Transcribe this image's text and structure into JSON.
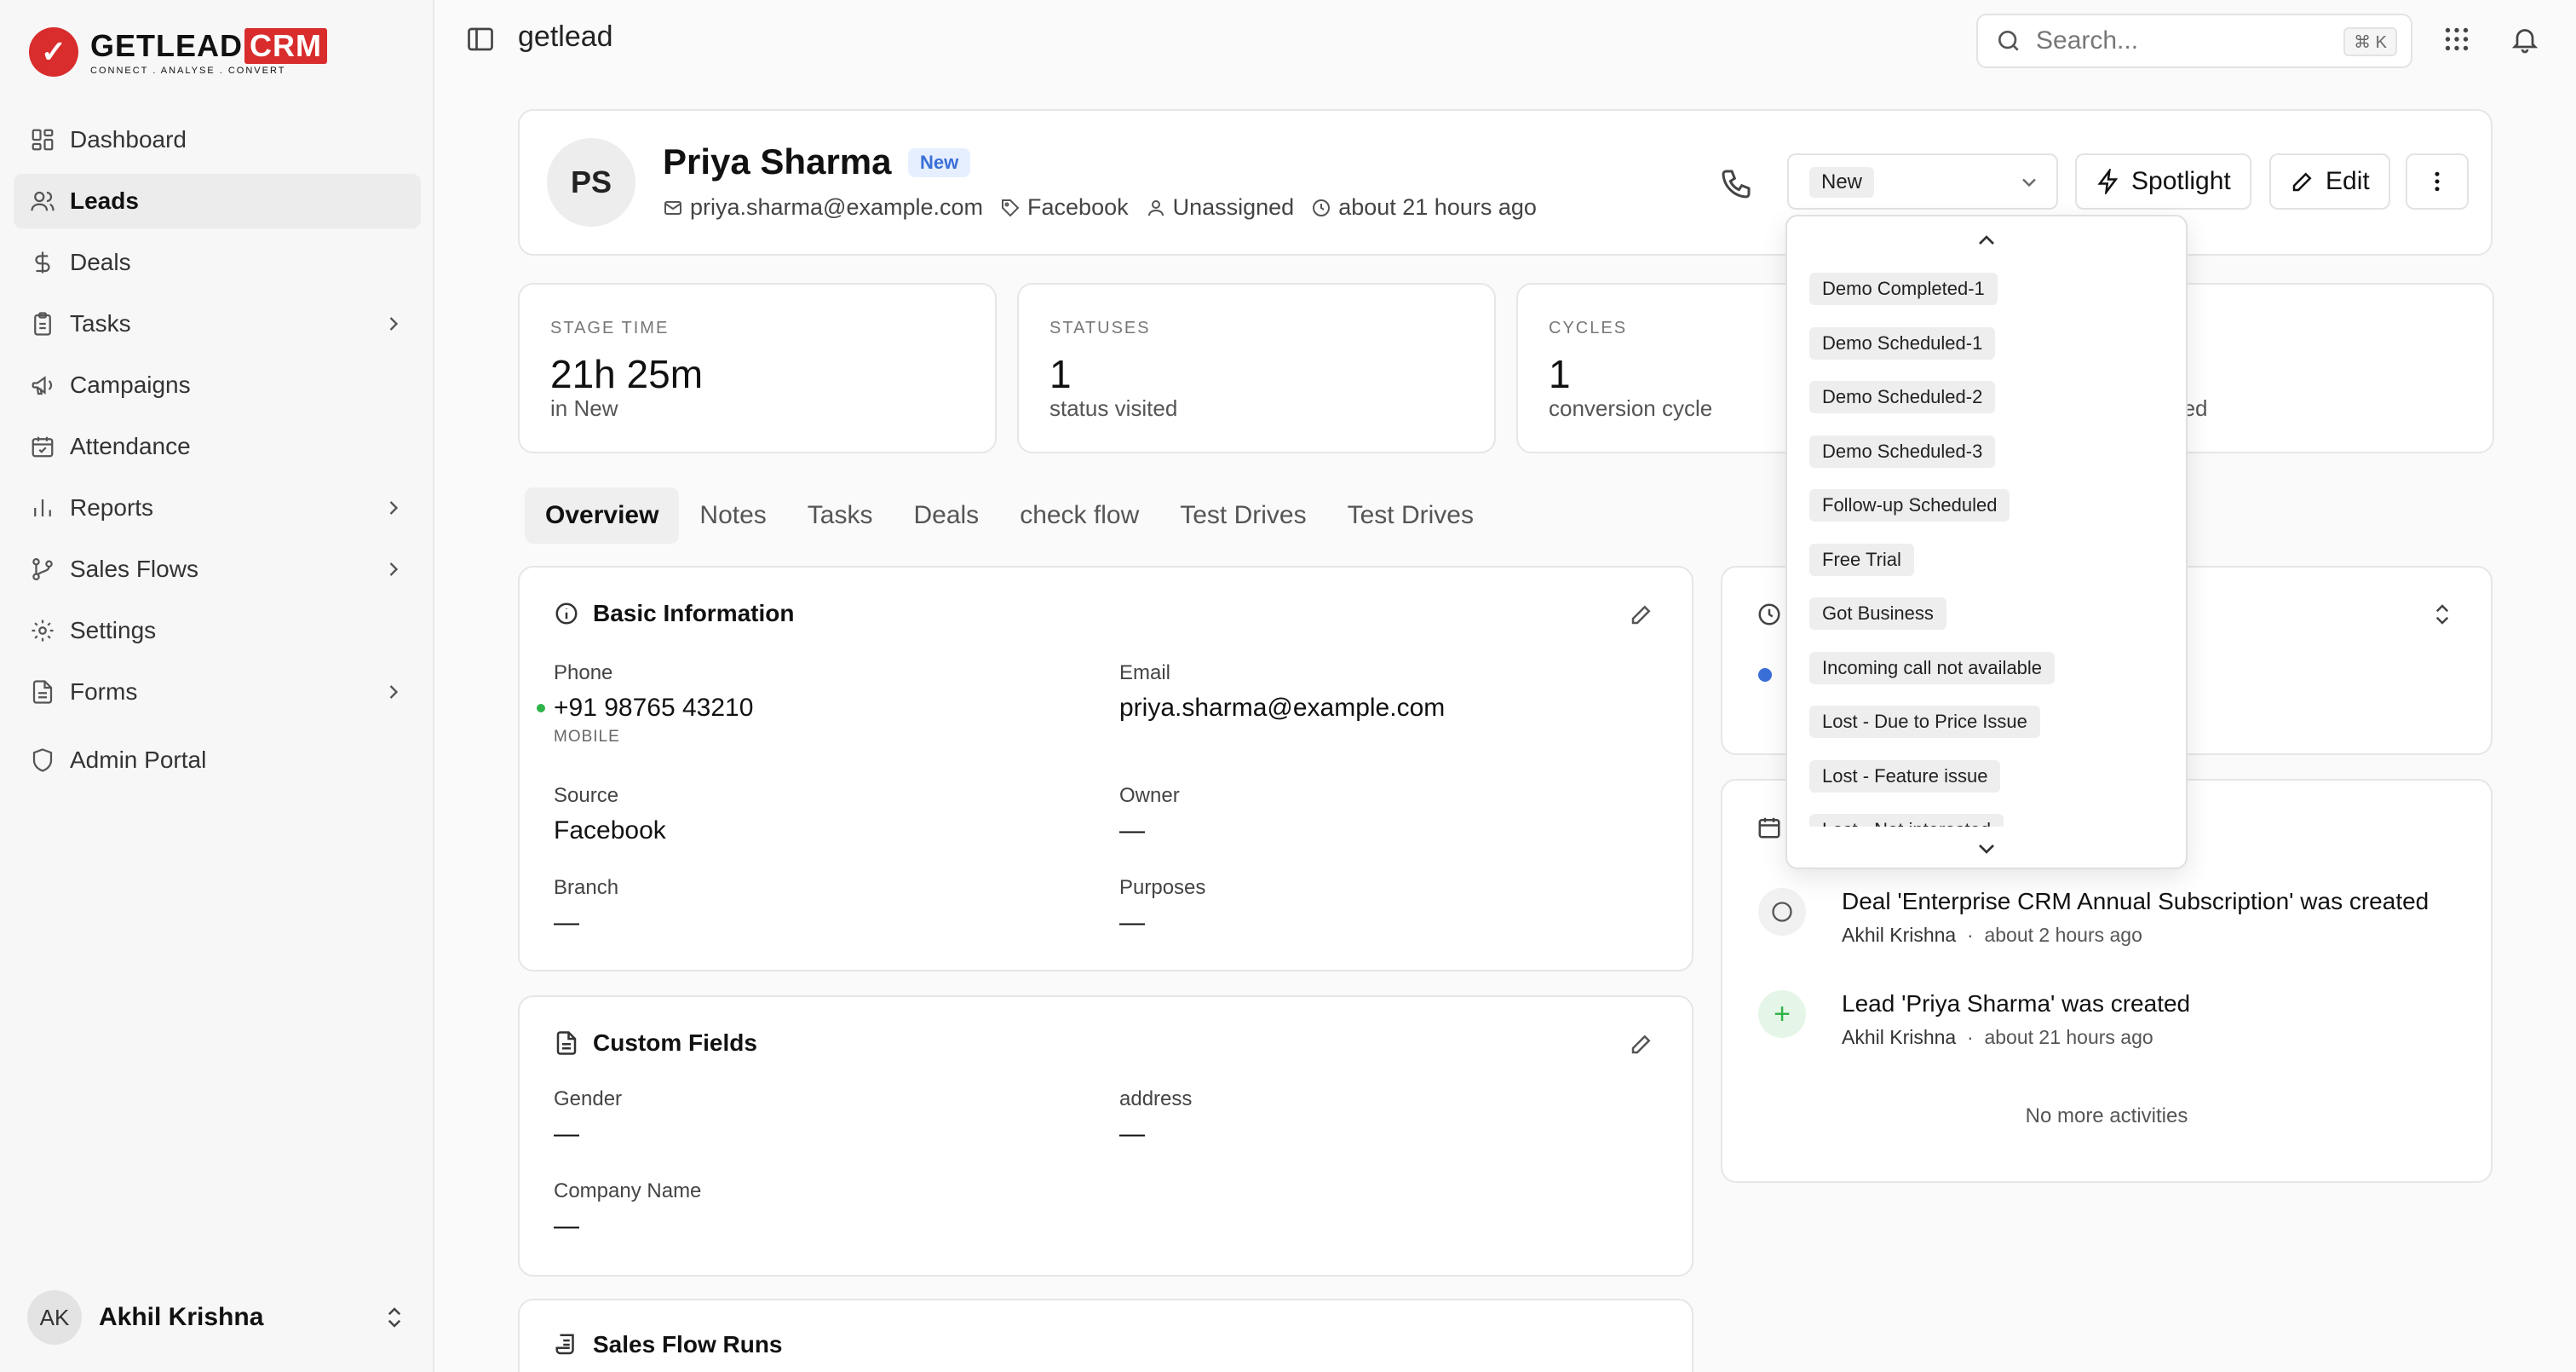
{
  "brand": {
    "name": "GETLEAD",
    "crm": "CRM",
    "tagline": "CONNECT . ANALYSE . CONVERT",
    "accent": "#d92c2c"
  },
  "sidebar": {
    "items": [
      {
        "label": "Dashboard",
        "icon": "grid-icon"
      },
      {
        "label": "Leads",
        "icon": "users-icon",
        "active": true
      },
      {
        "label": "Deals",
        "icon": "dollar-icon"
      },
      {
        "label": "Tasks",
        "icon": "clipboard-icon",
        "has_children": true
      },
      {
        "label": "Campaigns",
        "icon": "megaphone-icon"
      },
      {
        "label": "Attendance",
        "icon": "calendar-check-icon"
      },
      {
        "label": "Reports",
        "icon": "bar-chart-icon",
        "has_children": true
      },
      {
        "label": "Sales Flows",
        "icon": "git-branch-icon",
        "has_children": true
      },
      {
        "label": "Settings",
        "icon": "gear-icon"
      },
      {
        "label": "Forms",
        "icon": "file-icon",
        "has_children": true
      },
      {
        "label": "Admin Portal",
        "icon": "shield-icon"
      }
    ],
    "user": {
      "initials": "AK",
      "name": "Akhil Krishna"
    }
  },
  "topbar": {
    "title": "getlead",
    "search_placeholder": "Search...",
    "shortcut": "⌘ K"
  },
  "lead": {
    "initials": "PS",
    "name": "Priya Sharma",
    "badge": "New",
    "email": "priya.sharma@example.com",
    "source": "Facebook",
    "owner": "Unassigned",
    "created": "about 21 hours ago",
    "status": "New"
  },
  "actions": {
    "spotlight": "Spotlight",
    "edit": "Edit"
  },
  "stats": [
    {
      "label": "STAGE TIME",
      "value": "21h 25m",
      "sub": "in New"
    },
    {
      "label": "STATUSES",
      "value": "1",
      "sub": "status visited"
    },
    {
      "label": "CYCLES",
      "value": "1",
      "sub": "conversion cycle"
    },
    {
      "label": "",
      "value": "",
      "sub": "corded"
    }
  ],
  "tabs": [
    "Overview",
    "Notes",
    "Tasks",
    "Deals",
    "check flow",
    "Test Drives",
    "Test Drives"
  ],
  "basic_info": {
    "title": "Basic Information",
    "phone_label": "Phone",
    "phone": "+91 98765 43210",
    "phone_type": "MOBILE",
    "email_label": "Email",
    "email": "priya.sharma@example.com",
    "source_label": "Source",
    "source": "Facebook",
    "owner_label": "Owner",
    "owner": "—",
    "branch_label": "Branch",
    "branch": "—",
    "purposes_label": "Purposes",
    "purposes": "—"
  },
  "custom_fields": {
    "title": "Custom Fields",
    "gender_label": "Gender",
    "gender": "—",
    "address_label": "address",
    "address": "—",
    "company_label": "Company Name",
    "company": "—"
  },
  "sales_flow": {
    "title": "Sales Flow Runs"
  },
  "activities": [
    {
      "title": "Deal 'Enterprise CRM Annual Subscription' was created",
      "user": "Akhil Krishna",
      "time": "about 2 hours ago",
      "icon": "circle-icon"
    },
    {
      "title": "Lead 'Priya Sharma' was created",
      "user": "Akhil Krishna",
      "time": "about 21 hours ago",
      "icon": "plus-icon"
    }
  ],
  "no_more": "No more activities",
  "status_options": [
    "Demo Completed-1",
    "Demo Scheduled-1",
    "Demo Scheduled-2",
    "Demo Scheduled-3",
    "Follow-up Scheduled",
    "Free Trial",
    "Got Business",
    "Incoming call not available",
    "Lost - Due to Price Issue",
    "Lost - Feature issue",
    "Lost - Not interested"
  ]
}
